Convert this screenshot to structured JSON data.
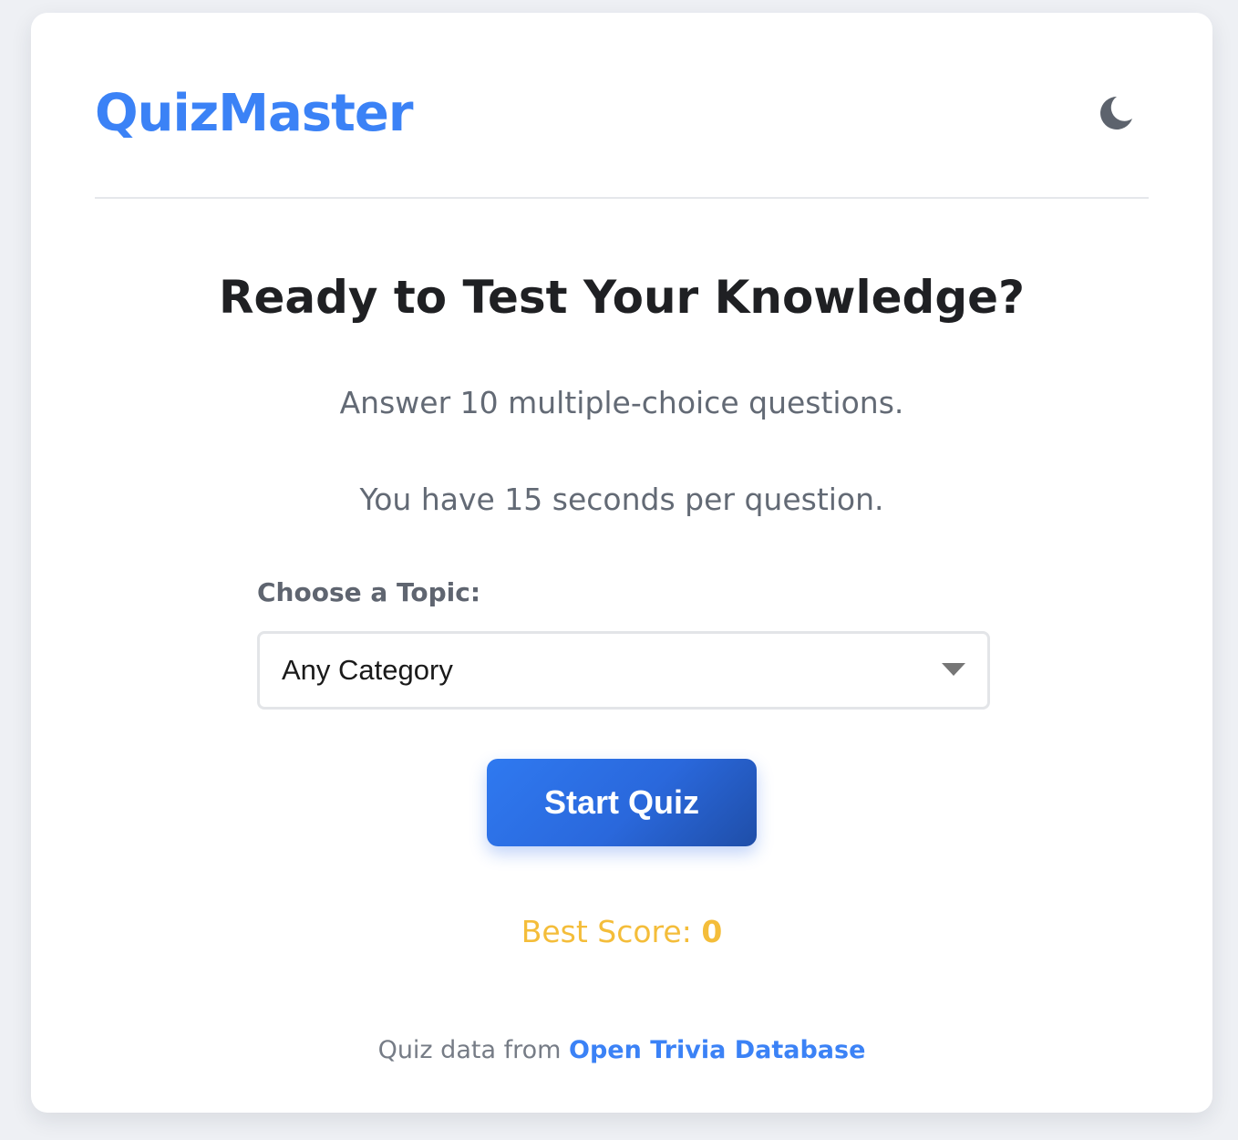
{
  "app": {
    "logo": "QuizMaster",
    "theme_toggle_icon": "moon-icon"
  },
  "intro": {
    "title": "Ready to Test Your Knowledge?",
    "line1": "Answer 10 multiple-choice questions.",
    "line2": "You have 15 seconds per question."
  },
  "topic": {
    "label": "Choose a Topic:",
    "selected": "Any Category",
    "dropdown_icon": "chevron-down-icon"
  },
  "actions": {
    "start_label": "Start Quiz"
  },
  "best_score": {
    "label": "Best Score:",
    "value": "0"
  },
  "footer": {
    "prefix": "Quiz data from",
    "link_text": "Open Trivia Database"
  },
  "colors": {
    "accent": "#3b82f6",
    "score": "#f4bd3a",
    "heading": "#1f2023",
    "muted": "#636a75"
  }
}
